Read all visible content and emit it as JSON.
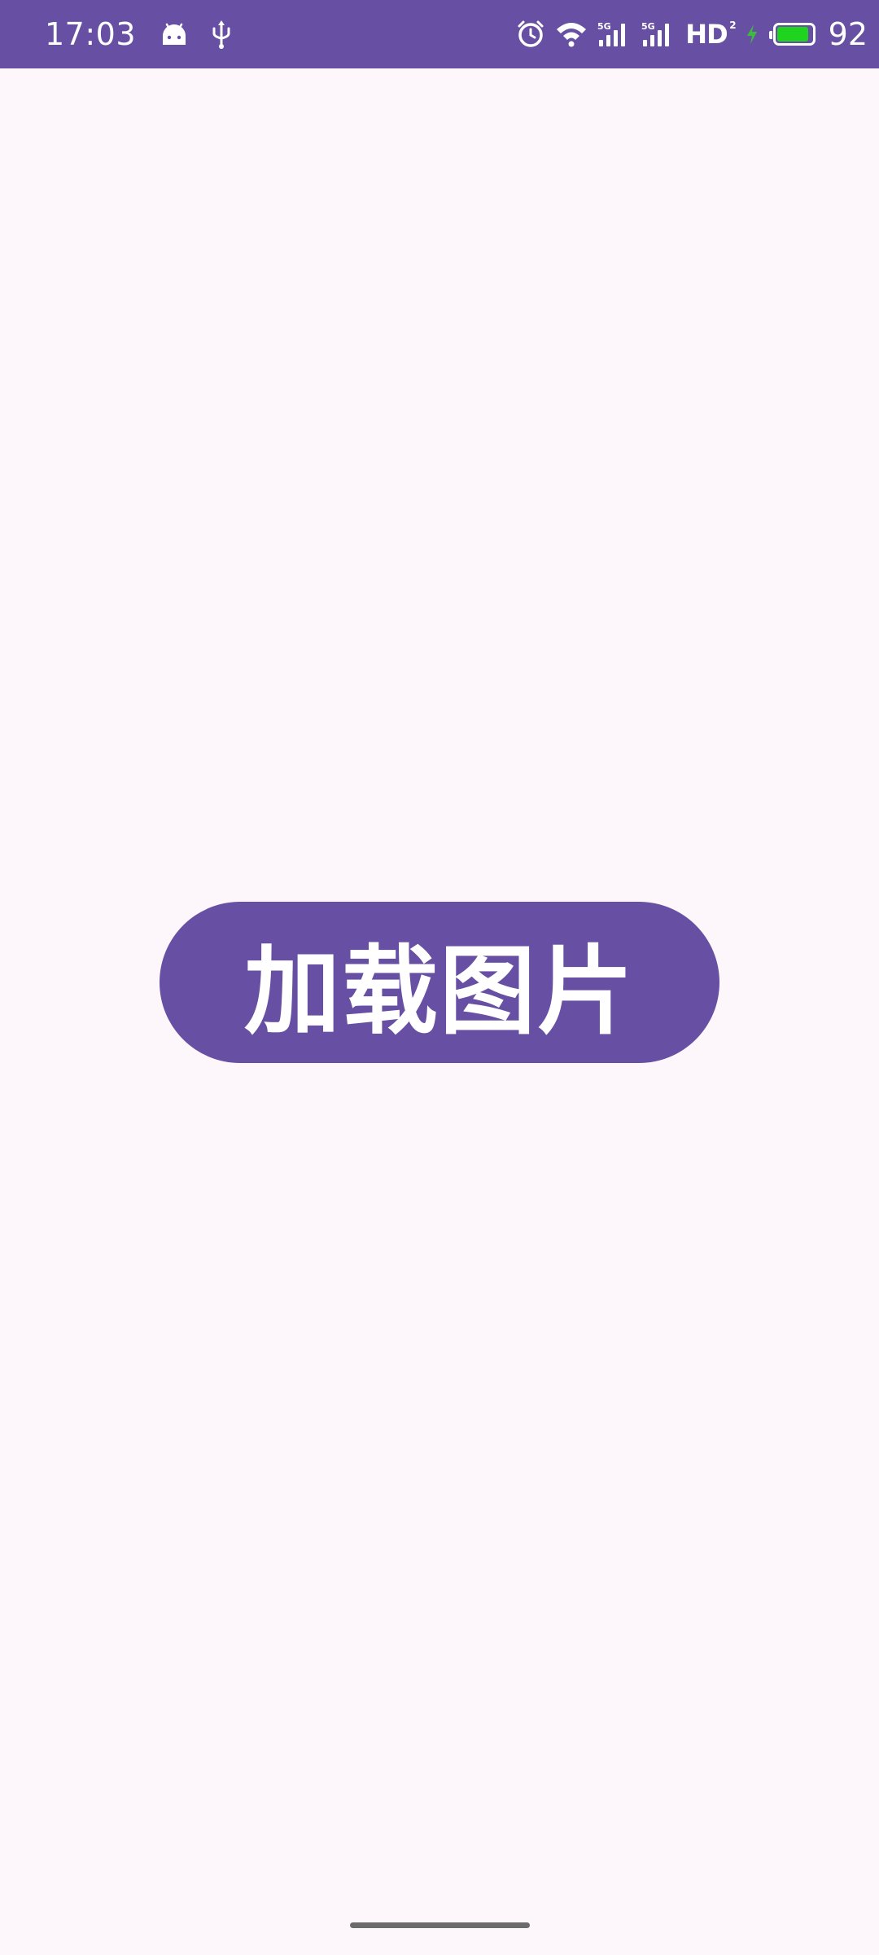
{
  "status_bar": {
    "time": "17:03",
    "network_1": "5G",
    "network_2": "5G",
    "hd_label": "HD",
    "hd_sup": "2",
    "battery_percent": "92",
    "battery_level": 0.92,
    "background_color": "#6750A4"
  },
  "main": {
    "load_button_label": "加载图片",
    "accent_color": "#6750A4",
    "background_color": "#FDF7FC"
  }
}
